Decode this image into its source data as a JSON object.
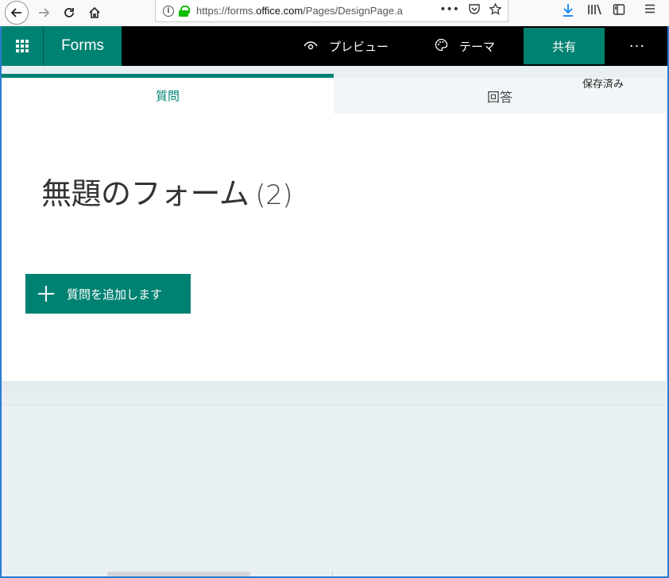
{
  "browser": {
    "url_prefix": "https://forms.",
    "url_domain": "office.com",
    "url_rest": "/Pages/DesignPage.a"
  },
  "header": {
    "brand": "Forms",
    "preview_label": "プレビュー",
    "theme_label": "テーマ",
    "share_label": "共有",
    "more_label": "···"
  },
  "tabs": {
    "questions_label": "質問",
    "responses_label": "回答",
    "saved_status": "保存済み"
  },
  "form": {
    "title": "無題のフォーム",
    "count": "(2)",
    "add_question_label": "質問を追加します"
  },
  "colors": {
    "accent": "#008272",
    "header_bg": "#000000",
    "page_bg": "#e9f0f4"
  },
  "icons": {
    "back": "back-arrow-icon",
    "forward": "forward-arrow-icon",
    "reload": "reload-icon",
    "home": "home-icon",
    "info": "info-icon",
    "lock": "lock-icon",
    "waffle": "app-launcher-icon",
    "preview": "eye-icon",
    "theme": "palette-icon",
    "add": "plus-icon"
  }
}
